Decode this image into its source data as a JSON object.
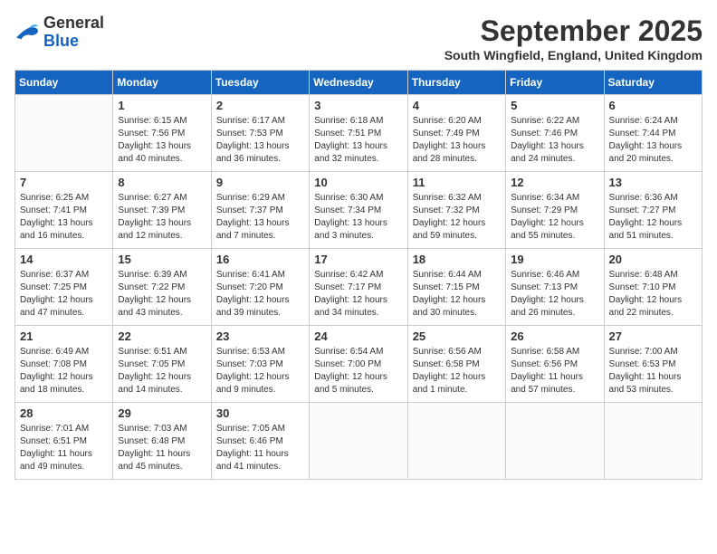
{
  "logo": {
    "general": "General",
    "blue": "Blue"
  },
  "header": {
    "month": "September 2025",
    "location": "South Wingfield, England, United Kingdom"
  },
  "weekdays": [
    "Sunday",
    "Monday",
    "Tuesday",
    "Wednesday",
    "Thursday",
    "Friday",
    "Saturday"
  ],
  "weeks": [
    [
      {
        "day": "",
        "sunrise": "",
        "sunset": "",
        "daylight": ""
      },
      {
        "day": "1",
        "sunrise": "Sunrise: 6:15 AM",
        "sunset": "Sunset: 7:56 PM",
        "daylight": "Daylight: 13 hours and 40 minutes."
      },
      {
        "day": "2",
        "sunrise": "Sunrise: 6:17 AM",
        "sunset": "Sunset: 7:53 PM",
        "daylight": "Daylight: 13 hours and 36 minutes."
      },
      {
        "day": "3",
        "sunrise": "Sunrise: 6:18 AM",
        "sunset": "Sunset: 7:51 PM",
        "daylight": "Daylight: 13 hours and 32 minutes."
      },
      {
        "day": "4",
        "sunrise": "Sunrise: 6:20 AM",
        "sunset": "Sunset: 7:49 PM",
        "daylight": "Daylight: 13 hours and 28 minutes."
      },
      {
        "day": "5",
        "sunrise": "Sunrise: 6:22 AM",
        "sunset": "Sunset: 7:46 PM",
        "daylight": "Daylight: 13 hours and 24 minutes."
      },
      {
        "day": "6",
        "sunrise": "Sunrise: 6:24 AM",
        "sunset": "Sunset: 7:44 PM",
        "daylight": "Daylight: 13 hours and 20 minutes."
      }
    ],
    [
      {
        "day": "7",
        "sunrise": "Sunrise: 6:25 AM",
        "sunset": "Sunset: 7:41 PM",
        "daylight": "Daylight: 13 hours and 16 minutes."
      },
      {
        "day": "8",
        "sunrise": "Sunrise: 6:27 AM",
        "sunset": "Sunset: 7:39 PM",
        "daylight": "Daylight: 13 hours and 12 minutes."
      },
      {
        "day": "9",
        "sunrise": "Sunrise: 6:29 AM",
        "sunset": "Sunset: 7:37 PM",
        "daylight": "Daylight: 13 hours and 7 minutes."
      },
      {
        "day": "10",
        "sunrise": "Sunrise: 6:30 AM",
        "sunset": "Sunset: 7:34 PM",
        "daylight": "Daylight: 13 hours and 3 minutes."
      },
      {
        "day": "11",
        "sunrise": "Sunrise: 6:32 AM",
        "sunset": "Sunset: 7:32 PM",
        "daylight": "Daylight: 12 hours and 59 minutes."
      },
      {
        "day": "12",
        "sunrise": "Sunrise: 6:34 AM",
        "sunset": "Sunset: 7:29 PM",
        "daylight": "Daylight: 12 hours and 55 minutes."
      },
      {
        "day": "13",
        "sunrise": "Sunrise: 6:36 AM",
        "sunset": "Sunset: 7:27 PM",
        "daylight": "Daylight: 12 hours and 51 minutes."
      }
    ],
    [
      {
        "day": "14",
        "sunrise": "Sunrise: 6:37 AM",
        "sunset": "Sunset: 7:25 PM",
        "daylight": "Daylight: 12 hours and 47 minutes."
      },
      {
        "day": "15",
        "sunrise": "Sunrise: 6:39 AM",
        "sunset": "Sunset: 7:22 PM",
        "daylight": "Daylight: 12 hours and 43 minutes."
      },
      {
        "day": "16",
        "sunrise": "Sunrise: 6:41 AM",
        "sunset": "Sunset: 7:20 PM",
        "daylight": "Daylight: 12 hours and 39 minutes."
      },
      {
        "day": "17",
        "sunrise": "Sunrise: 6:42 AM",
        "sunset": "Sunset: 7:17 PM",
        "daylight": "Daylight: 12 hours and 34 minutes."
      },
      {
        "day": "18",
        "sunrise": "Sunrise: 6:44 AM",
        "sunset": "Sunset: 7:15 PM",
        "daylight": "Daylight: 12 hours and 30 minutes."
      },
      {
        "day": "19",
        "sunrise": "Sunrise: 6:46 AM",
        "sunset": "Sunset: 7:13 PM",
        "daylight": "Daylight: 12 hours and 26 minutes."
      },
      {
        "day": "20",
        "sunrise": "Sunrise: 6:48 AM",
        "sunset": "Sunset: 7:10 PM",
        "daylight": "Daylight: 12 hours and 22 minutes."
      }
    ],
    [
      {
        "day": "21",
        "sunrise": "Sunrise: 6:49 AM",
        "sunset": "Sunset: 7:08 PM",
        "daylight": "Daylight: 12 hours and 18 minutes."
      },
      {
        "day": "22",
        "sunrise": "Sunrise: 6:51 AM",
        "sunset": "Sunset: 7:05 PM",
        "daylight": "Daylight: 12 hours and 14 minutes."
      },
      {
        "day": "23",
        "sunrise": "Sunrise: 6:53 AM",
        "sunset": "Sunset: 7:03 PM",
        "daylight": "Daylight: 12 hours and 9 minutes."
      },
      {
        "day": "24",
        "sunrise": "Sunrise: 6:54 AM",
        "sunset": "Sunset: 7:00 PM",
        "daylight": "Daylight: 12 hours and 5 minutes."
      },
      {
        "day": "25",
        "sunrise": "Sunrise: 6:56 AM",
        "sunset": "Sunset: 6:58 PM",
        "daylight": "Daylight: 12 hours and 1 minute."
      },
      {
        "day": "26",
        "sunrise": "Sunrise: 6:58 AM",
        "sunset": "Sunset: 6:56 PM",
        "daylight": "Daylight: 11 hours and 57 minutes."
      },
      {
        "day": "27",
        "sunrise": "Sunrise: 7:00 AM",
        "sunset": "Sunset: 6:53 PM",
        "daylight": "Daylight: 11 hours and 53 minutes."
      }
    ],
    [
      {
        "day": "28",
        "sunrise": "Sunrise: 7:01 AM",
        "sunset": "Sunset: 6:51 PM",
        "daylight": "Daylight: 11 hours and 49 minutes."
      },
      {
        "day": "29",
        "sunrise": "Sunrise: 7:03 AM",
        "sunset": "Sunset: 6:48 PM",
        "daylight": "Daylight: 11 hours and 45 minutes."
      },
      {
        "day": "30",
        "sunrise": "Sunrise: 7:05 AM",
        "sunset": "Sunset: 6:46 PM",
        "daylight": "Daylight: 11 hours and 41 minutes."
      },
      {
        "day": "",
        "sunrise": "",
        "sunset": "",
        "daylight": ""
      },
      {
        "day": "",
        "sunrise": "",
        "sunset": "",
        "daylight": ""
      },
      {
        "day": "",
        "sunrise": "",
        "sunset": "",
        "daylight": ""
      },
      {
        "day": "",
        "sunrise": "",
        "sunset": "",
        "daylight": ""
      }
    ]
  ]
}
